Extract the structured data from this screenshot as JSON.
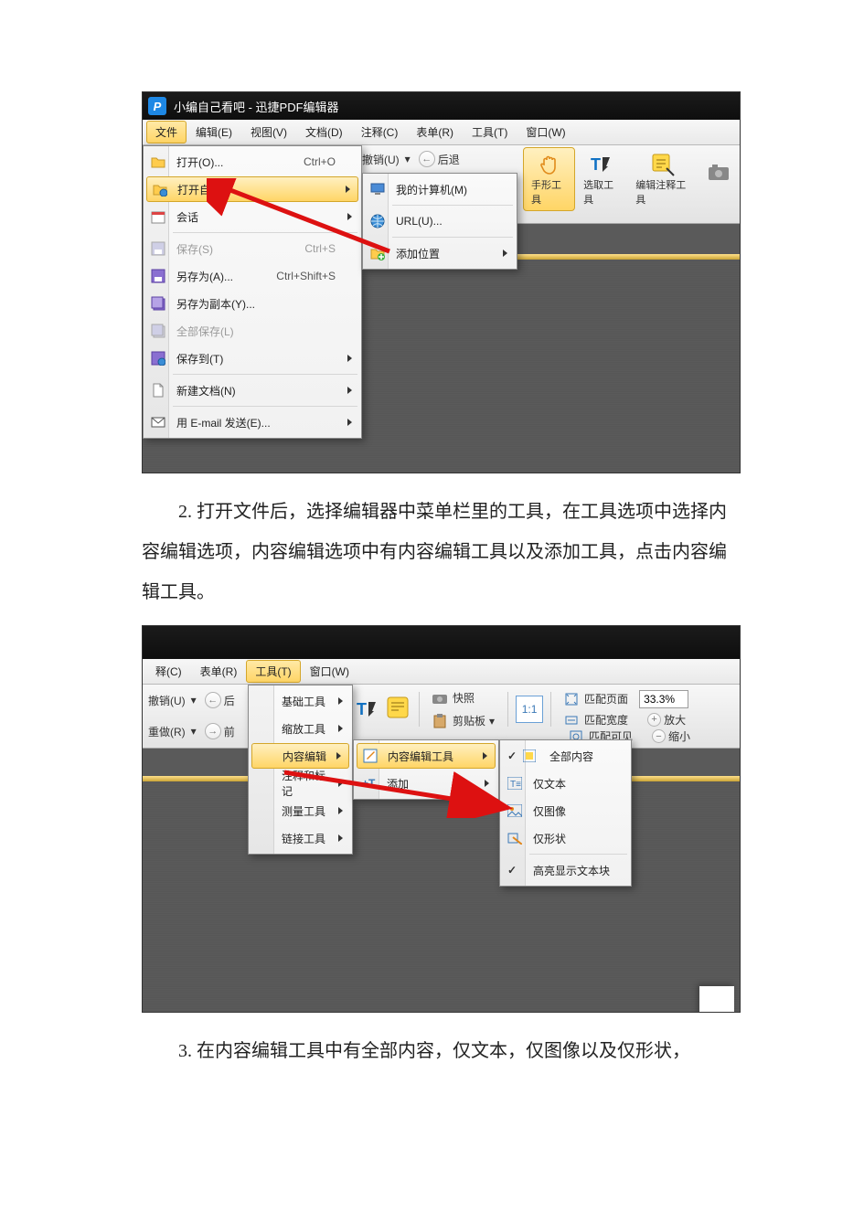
{
  "shot1": {
    "title": "小编自己看吧 - 迅捷PDF编辑器",
    "menus": [
      "文件",
      "编辑(E)",
      "视图(V)",
      "文档(D)",
      "注释(C)",
      "表单(R)",
      "工具(T)",
      "窗口(W)"
    ],
    "active_menu_index": 0,
    "file_menu": {
      "open": {
        "label": "打开(O)...",
        "shortcut": "Ctrl+O"
      },
      "open_from": {
        "label": "打开自(F)"
      },
      "session": {
        "label": "会话"
      },
      "save": {
        "label": "保存(S)",
        "shortcut": "Ctrl+S"
      },
      "save_as": {
        "label": "另存为(A)...",
        "shortcut": "Ctrl+Shift+S"
      },
      "save_as_copy": {
        "label": "另存为副本(Y)..."
      },
      "save_all": {
        "label": "全部保存(L)"
      },
      "save_to": {
        "label": "保存到(T)"
      },
      "new_doc": {
        "label": "新建文档(N)"
      },
      "email": {
        "label": "用 E-mail 发送(E)..."
      }
    },
    "open_from_sub": {
      "my_computer": "我的计算机(M)",
      "url": "URL(U)...",
      "add_location": "添加位置"
    },
    "undo_label": "撤销(U)",
    "redo_label": "后退",
    "toolbar": {
      "hand": "手形工具",
      "select": "选取工具",
      "annot": "编辑注释工具"
    }
  },
  "para2": "2. 打开文件后，选择编辑器中菜单栏里的工具，在工具选项中选择内容编辑选项，内容编辑选项中有内容编辑工具以及添加工具，点击内容编辑工具。",
  "shot2": {
    "menus_right": [
      "释(C)",
      "表单(R)",
      "工具(T)",
      "窗口(W)"
    ],
    "active_menu_index": 2,
    "row1": {
      "undo": "撤销(U)",
      "redo_char": "后"
    },
    "row2": {
      "redo": "重做(R)",
      "fwd_char": "前"
    },
    "tools_menu": {
      "basic": "基础工具",
      "zoom": "缩放工具",
      "content": "内容编辑",
      "annot": "注释和标记",
      "measure": "测量工具",
      "link": "链接工具"
    },
    "content_sub": {
      "edit_tool": "内容编辑工具",
      "add": "添加"
    },
    "content_sub2": {
      "all": "全部内容",
      "text": "仅文本",
      "image": "仅图像",
      "shape": "仅形状",
      "highlight": "高亮显示文本块"
    },
    "right_tools": {
      "snapshot": "快照",
      "clipboard": "剪贴板",
      "fit_page": "匹配页面",
      "fit_width": "匹配宽度",
      "fit_visible": "匹配可见",
      "zoom_in": "放大",
      "zoom_out": "缩小",
      "zoom_value": "33.3%"
    }
  },
  "para3": "3. 在内容编辑工具中有全部内容，仅文本，仅图像以及仅形状，"
}
